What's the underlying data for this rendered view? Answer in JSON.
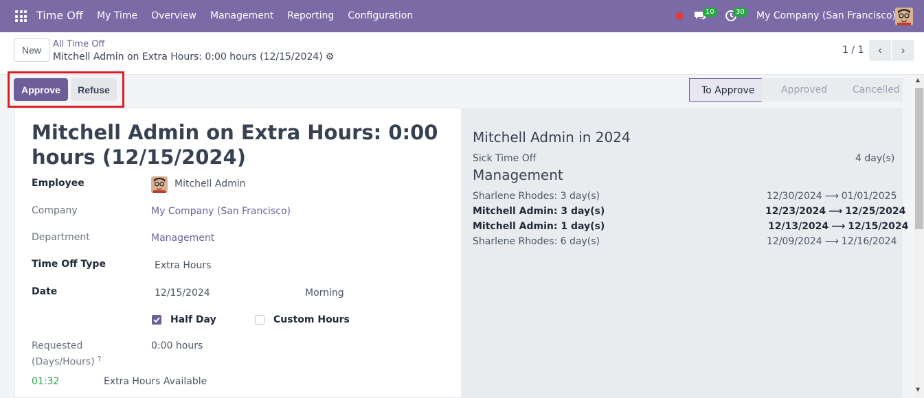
{
  "navbar": {
    "app_name": "Time Off",
    "menu": [
      "My Time",
      "Overview",
      "Management",
      "Reporting",
      "Configuration"
    ],
    "chat_count": "10",
    "activity_count": "30",
    "company": "My Company (San Francisco)"
  },
  "control": {
    "new_label": "New",
    "breadcrumb_parent": "All Time Off",
    "breadcrumb_current": "Mitchell Admin on Extra Hours: 0:00 hours (12/15/2024)",
    "pager": "1 / 1"
  },
  "statusbar": {
    "approve_label": "Approve",
    "refuse_label": "Refuse",
    "stages": [
      "To Approve",
      "Approved",
      "Cancelled"
    ],
    "active_stage": "To Approve"
  },
  "form": {
    "title": "Mitchell Admin on Extra Hours: 0:00 hours (12/15/2024)",
    "employee_label": "Employee",
    "employee_value": "Mitchell Admin",
    "company_label": "Company",
    "company_value": "My Company (San Francisco)",
    "department_label": "Department",
    "department_value": "Management",
    "type_label": "Time Off Type",
    "type_value": "Extra Hours",
    "date_label": "Date",
    "date_value": "12/15/2024",
    "period_value": "Morning",
    "half_day_label": "Half Day",
    "half_day_checked": true,
    "custom_hours_label": "Custom Hours",
    "custom_hours_checked": false,
    "requested_label_1": "Requested",
    "requested_label_2": "(Days/Hours)",
    "requested_help": "?",
    "requested_value": "0:00 hours",
    "extra_hours_value": "01:32",
    "extra_hours_label": "Extra Hours Available"
  },
  "side": {
    "title": "Mitchell Admin in 2024",
    "sick_label": "Sick Time Off",
    "sick_value": "4 day(s)",
    "heading": "Management",
    "rows": [
      {
        "name": "Sharlene Rhodes: 3 day(s)",
        "from": "12/30/2024",
        "to": "01/01/2025",
        "bold": false
      },
      {
        "name": "Mitchell Admin: 3 day(s)",
        "from": "12/23/2024",
        "to": "12/25/2024",
        "bold": true
      },
      {
        "name": "Mitchell Admin: 1 day(s)",
        "from": "12/13/2024",
        "to": "12/15/2024",
        "bold": true
      },
      {
        "name": "Sharlene Rhodes: 6 day(s)",
        "from": "12/09/2024",
        "to": "12/16/2024",
        "bold": false
      }
    ]
  },
  "colors": {
    "navbar": "#7a6aa6",
    "primary": "#6d5e99",
    "highlight": "#d61f26",
    "success": "#28a745"
  }
}
